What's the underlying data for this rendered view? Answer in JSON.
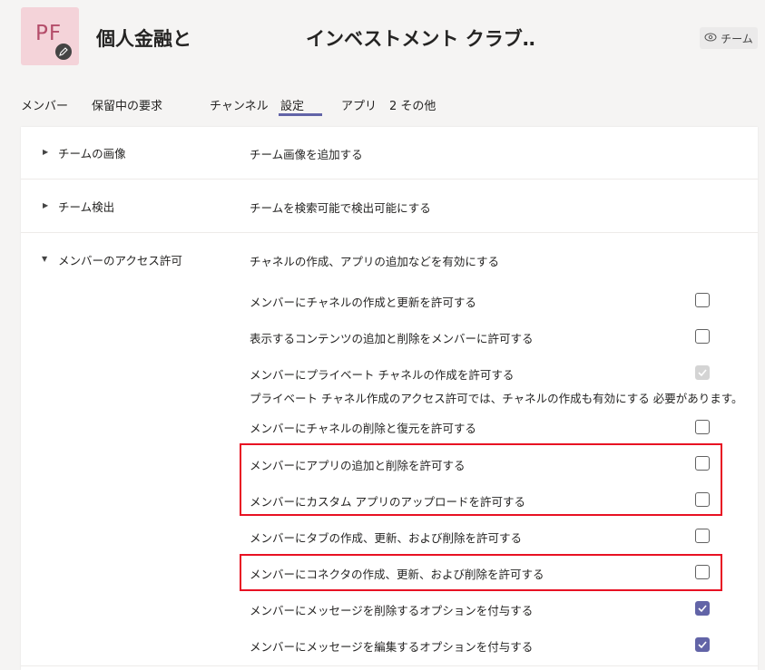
{
  "header": {
    "avatar_initials": "PF",
    "team_name_part1": "個人金融と",
    "team_name_part2": "インベストメント クラブ‥",
    "team_button_label": "チーム"
  },
  "tabs": [
    {
      "label": "メンバー"
    },
    {
      "label": "保留中の要求"
    },
    {
      "label": "チャンネル"
    },
    {
      "label": "設定",
      "active": true
    },
    {
      "label": "アプリ"
    }
  ],
  "tabs_more": {
    "count": "2",
    "label": "その他"
  },
  "sections": {
    "team_picture": {
      "title": "チームの画像",
      "description": "チーム画像を追加する"
    },
    "team_discovery": {
      "title": "チーム検出",
      "description": "チームを検索可能で検出可能にする"
    },
    "member_permissions": {
      "title": "メンバーのアクセス許可",
      "description": "チャネルの作成、アプリの追加などを有効にする"
    }
  },
  "options": [
    {
      "label": "メンバーにチャネルの作成と更新を許可する",
      "checked": false
    },
    {
      "label": "表示するコンテンツの追加と削除をメンバーに許可する",
      "checked": false
    },
    {
      "label": "メンバーにプライベート チャネルの作成を許可する",
      "checked": true,
      "disabled": true,
      "note": "プライベート チャネル作成のアクセス許可では、チャネルの作成も有効にする 必要があります。"
    },
    {
      "label": "メンバーにチャネルの削除と復元を許可する",
      "checked": false
    },
    {
      "label": "メンバーにアプリの追加と削除を許可する",
      "checked": false,
      "highlighted": true
    },
    {
      "label": "メンバーにカスタム アプリのアップロードを許可する",
      "checked": false,
      "highlighted": true
    },
    {
      "label": "メンバーにタブの作成、更新、および削除を許可する",
      "checked": false
    },
    {
      "label": "メンバーにコネクタの作成、更新、および削除を許可する",
      "checked": false,
      "highlighted": true
    },
    {
      "label": "メンバーにメッセージを削除するオプションを付与する",
      "checked": true
    },
    {
      "label": "メンバーにメッセージを編集するオプションを付与する",
      "checked": true
    }
  ],
  "colors": {
    "accent": "#6264a7",
    "highlight": "#e81123",
    "avatar_bg": "#f4d3d9"
  }
}
